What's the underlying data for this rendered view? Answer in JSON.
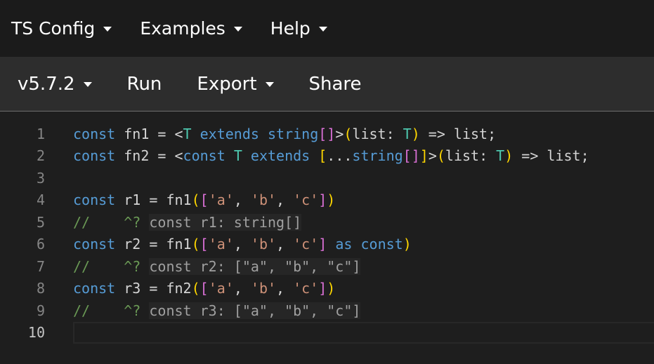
{
  "topbar": {
    "items": [
      {
        "label": "TS Config",
        "has_dropdown": true
      },
      {
        "label": "Examples",
        "has_dropdown": true
      },
      {
        "label": "Help",
        "has_dropdown": true
      }
    ]
  },
  "toolbar": {
    "version_label": "v5.7.2",
    "run_label": "Run",
    "export_label": "Export",
    "share_label": "Share"
  },
  "editor": {
    "line_numbers": [
      "1",
      "2",
      "3",
      "4",
      "5",
      "6",
      "7",
      "8",
      "9",
      "10"
    ],
    "lines": [
      "const fn1 = <T extends string[]>(list: T) => list;",
      "const fn2 = <const T extends [...string[]]>(list: T) => list;",
      "",
      "const r1 = fn1(['a', 'b', 'c'])",
      "//    ^? const r1: string[]",
      "const r2 = fn1(['a', 'b', 'c'] as const)",
      "//    ^? const r2: [\"a\", \"b\", \"c\"]",
      "const r3 = fn2(['a', 'b', 'c'])",
      "//    ^? const r3: [\"a\", \"b\", \"c\"]",
      ""
    ],
    "hints": [
      "const r1: string[]",
      "const r2: [\"a\", \"b\", \"c\"]",
      "const r3: [\"a\", \"b\", \"c\"]"
    ],
    "active_line": 10
  },
  "colors": {
    "keyword": "#569cd6",
    "type": "#4ec9b0",
    "string": "#ce9178",
    "bracket_gold": "#ffd700",
    "bracket_purple": "#da70d6",
    "bracket_blue": "#179fff",
    "comment": "#6a9955",
    "topbar_bg": "#1b1b1b",
    "toolbar_bg": "#2d2d2d",
    "editor_bg": "#1e1e1e"
  }
}
